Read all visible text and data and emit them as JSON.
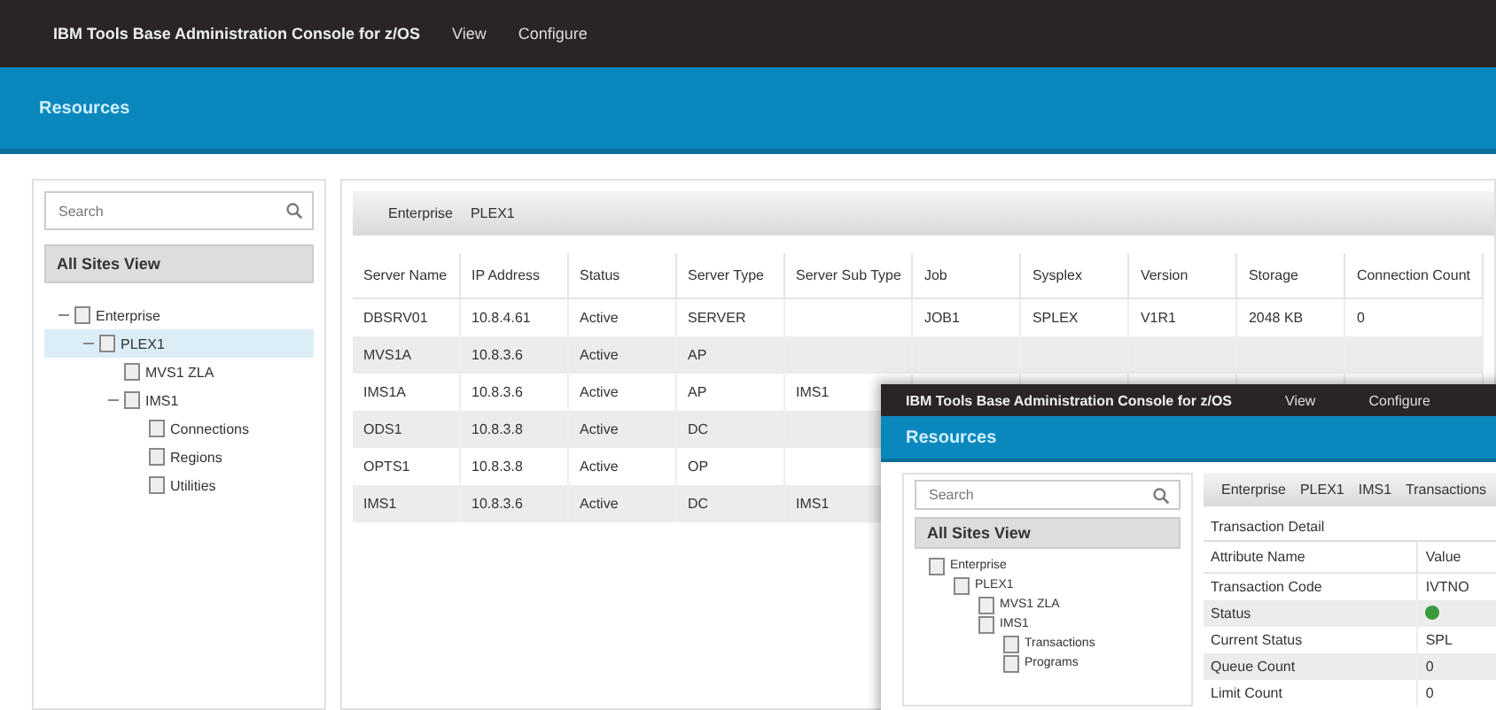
{
  "window": {
    "title": "IBM Tools Base Administration Console for z/OS",
    "menu": [
      "View",
      "Configure"
    ]
  },
  "banner": {
    "title": "Resources"
  },
  "sidebar": {
    "search": {
      "placeholder": "Search"
    },
    "view": "All Sites View",
    "tree": [
      {
        "label": "Enterprise",
        "selected": false,
        "children": [
          {
            "label": "PLEX1",
            "selected": true,
            "children": [
              {
                "label": "MVS1 ZLA",
                "selected": false
              },
              {
                "label": "IMS1",
                "selected": false,
                "children": [
                  {
                    "label": "Connections",
                    "selected": false
                  },
                  {
                    "label": "Regions",
                    "selected": false
                  },
                  {
                    "label": "Utilities",
                    "selected": false
                  }
                ]
              }
            ]
          }
        ]
      }
    ]
  },
  "breadcrumb": [
    "Enterprise",
    "PLEX1"
  ],
  "table": {
    "columns": [
      "Server Name",
      "IP Address",
      "Status",
      "Server Type",
      "Server Sub Type",
      "Job",
      "Sysplex",
      "Version",
      "Storage",
      "Connection Count"
    ],
    "rows": [
      [
        "DBSRV01",
        "10.8.4.61",
        "Active",
        "SERVER",
        "",
        "JOB1",
        "SPLEX",
        "V1R1",
        "2048 KB",
        "0"
      ],
      [
        "MVS1A",
        "10.8.3.6",
        "Active",
        "AP",
        "",
        "",
        "",
        "",
        "",
        ""
      ],
      [
        "IMS1A",
        "10.8.3.6",
        "Active",
        "AP",
        "IMS1",
        "",
        "",
        "",
        "",
        ""
      ],
      [
        "ODS1",
        "10.8.3.8",
        "Active",
        "DC",
        "",
        "",
        "",
        "",
        "",
        ""
      ],
      [
        "OPTS1",
        "10.8.3.8",
        "Active",
        "OP",
        "",
        "",
        "",
        "",
        "",
        ""
      ],
      [
        "IMS1",
        "10.8.3.6",
        "Active",
        "DC",
        "IMS1",
        "",
        "",
        "",
        "",
        ""
      ]
    ]
  },
  "popup": {
    "title": "IBM Tools Base Administration Console for z/OS",
    "menu": [
      "View",
      "Configure"
    ],
    "banner": "Resources",
    "search": {
      "placeholder": "Search"
    },
    "view": "All Sites View",
    "tree": [
      {
        "label": "Enterprise",
        "children": [
          {
            "label": "PLEX1",
            "children": [
              {
                "label": "MVS1 ZLA"
              },
              {
                "label": "IMS1",
                "children": [
                  {
                    "label": "Transactions"
                  },
                  {
                    "label": "Programs"
                  }
                ]
              }
            ]
          }
        ]
      }
    ],
    "breadcrumb": [
      "Enterprise",
      "PLEX1",
      "IMS1",
      "Transactions"
    ],
    "detail_title": "Transaction Detail",
    "columns": [
      "Attribute Name",
      "Value"
    ],
    "rows": [
      {
        "kind": "text",
        "name": "Transaction Code",
        "value": "IVTNO"
      },
      {
        "kind": "status",
        "name": "Status",
        "on": true
      },
      {
        "kind": "text",
        "name": "Current Status",
        "value": "SPL"
      },
      {
        "kind": "text",
        "name": "Queue Count",
        "value": "0"
      },
      {
        "kind": "text",
        "name": "Limit Count",
        "value": "0"
      }
    ]
  }
}
